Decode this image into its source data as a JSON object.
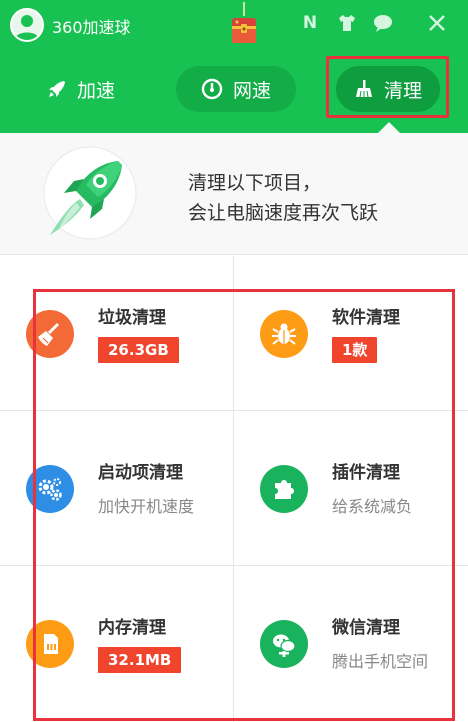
{
  "app": {
    "title": "360加速球"
  },
  "toolbar_icons": [
    "n-icon",
    "shirt-icon",
    "chat-icon",
    "close-icon"
  ],
  "toolbar_glyphs": {
    "n": "N"
  },
  "tabs": [
    {
      "label": "加速",
      "icon": "rocket-icon"
    },
    {
      "label": "网速",
      "icon": "speedometer-icon"
    },
    {
      "label": "清理",
      "icon": "broom-icon",
      "active": true
    }
  ],
  "banner": {
    "line1": "清理以下项目，",
    "line2": "会让电脑速度再次飞跃"
  },
  "items": [
    {
      "name": "垃圾清理",
      "badge": "26.3GB",
      "icon": "broom-icon",
      "color": "#f46a36"
    },
    {
      "name": "软件清理",
      "badge": "1款",
      "icon": "bug-icon",
      "color": "#ff9c16"
    },
    {
      "name": "启动项清理",
      "desc": "加快开机速度",
      "icon": "gears-icon",
      "color": "#2e8ee6"
    },
    {
      "name": "插件清理",
      "desc": "给系统减负",
      "icon": "puzzle-icon",
      "color": "#19b25d"
    },
    {
      "name": "内存清理",
      "badge": "32.1MB",
      "icon": "memory-icon",
      "color": "#ff9c16"
    },
    {
      "name": "微信清理",
      "desc": "腾出手机空间",
      "icon": "wechat-icon",
      "color": "#19b25d"
    }
  ],
  "colors": {
    "brand": "#17c252",
    "highlight": "#e8333e",
    "badge": "#f0442c"
  }
}
